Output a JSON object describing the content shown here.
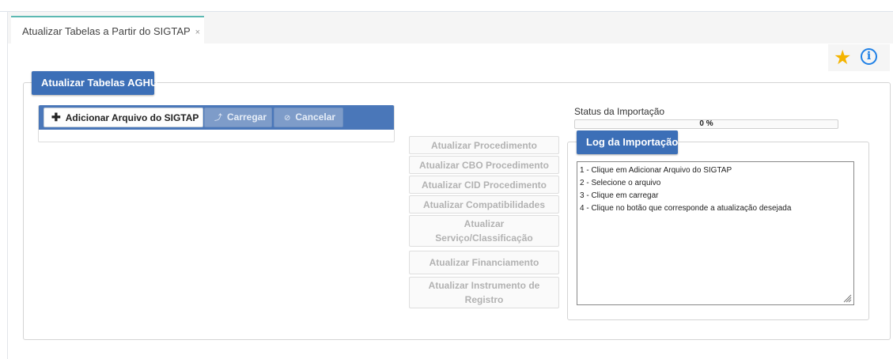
{
  "tab": {
    "title": "Atualizar Tabelas a Partir do SIGTAP",
    "close_glyph": "×"
  },
  "toolbar": {
    "favorite_icon": "star-icon",
    "info_icon": "info-icon",
    "star_color": "#f4b400",
    "info_color": "#1f80e6"
  },
  "panel": {
    "title": "Atualizar Tabelas AGHU",
    "upload": {
      "add_label": "Adicionar Arquivo do SIGTAP",
      "upload_label": "Carregar",
      "cancel_label": "Cancelar"
    },
    "status": {
      "label": "Status da Importação",
      "progress_value": 0,
      "progress_text": "0 %"
    },
    "actions": [
      "Atualizar Procedimento",
      "Atualizar CBO Procedimento",
      "Atualizar CID Procedimento",
      "Atualizar Compatibilidades",
      "Atualizar Serviço/Classificação",
      "Atualizar Financiamento",
      "Atualizar Instrumento de Registro"
    ],
    "log": {
      "title": "Log da Importação",
      "lines": [
        "1 - Clique em Adicionar Arquivo do SIGTAP",
        "2 - Selecione o arquivo",
        "3 - Clique em carregar",
        "4 - Clique no botão que corresponde a atualização desejada"
      ]
    }
  },
  "colors": {
    "accent": "#3c6fb7",
    "tab_border": "#5cb8b2",
    "toolbar_bar": "#4a77b9"
  }
}
